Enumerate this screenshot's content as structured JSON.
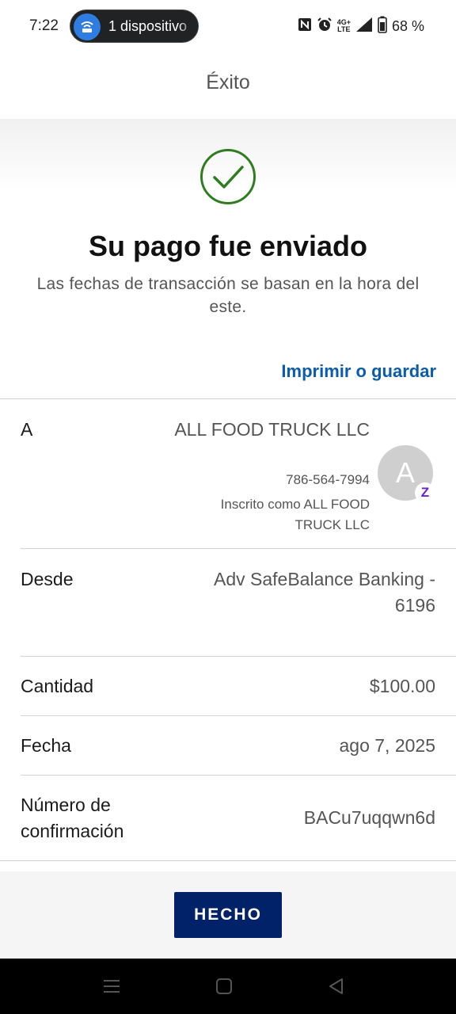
{
  "status_bar": {
    "time": "7:22",
    "hotspot_text": "1 dispositivo",
    "network_top": "4G+",
    "network_bottom": "LTE",
    "battery": "68 %"
  },
  "header": {
    "title": "Éxito"
  },
  "success": {
    "title": "Su pago fue enviado",
    "subtitle": "Las fechas de transacción se basan en la hora del este.",
    "check_color": "#2e7d1f"
  },
  "print_save_label": "Imprimir o guardar",
  "recipient": {
    "label": "A",
    "name": "ALL FOOD TRUCK LLC",
    "phone": "786-564-7994",
    "enrolled_as": "Inscrito como ALL FOOD TRUCK LLC",
    "avatar_letter": "A",
    "badge_letter": "Z"
  },
  "details": [
    {
      "label": "Desde",
      "value": "Adv SafeBalance Banking - 6196"
    },
    {
      "label": "Cantidad",
      "value": "$100.00"
    },
    {
      "label": "Fecha",
      "value": "ago 7, 2025"
    },
    {
      "label": "Número de confirmación",
      "value": "BACu7uqqwn6d"
    }
  ],
  "done_label": "HECHO",
  "colors": {
    "accent_link": "#0b5cab",
    "primary_button": "#012169",
    "zelle": "#6d1ed4"
  }
}
